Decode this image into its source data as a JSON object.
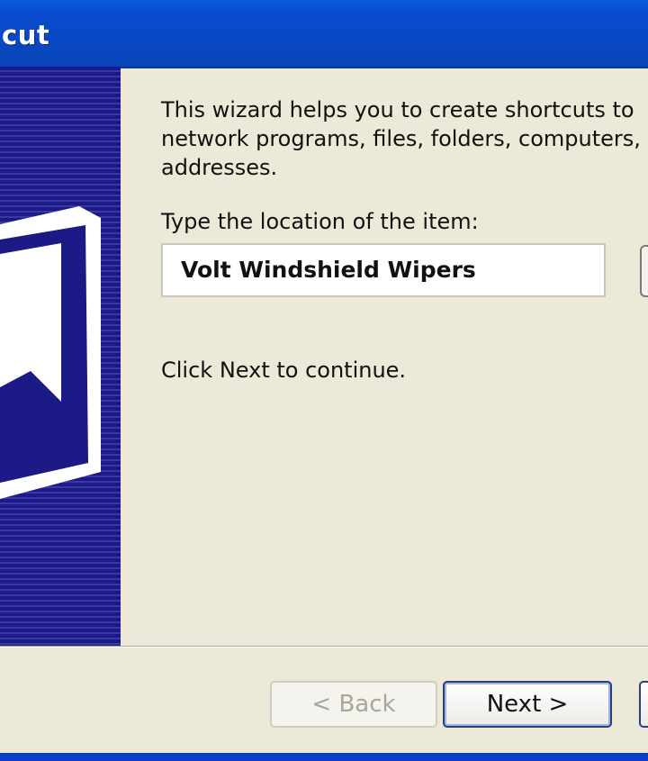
{
  "window": {
    "title": "cut"
  },
  "wizard": {
    "description": "This wizard helps you to create shortcuts to\nnetwork programs, files, folders, computers,\naddresses.",
    "location_label": "Type the location of the item:",
    "location_value": "Volt Windshield Wipers",
    "continue_hint": "Click Next to continue."
  },
  "buttons": {
    "back_label": "< Back",
    "next_label": "Next >"
  },
  "icons": {
    "sidebar": "shortcut-book-icon",
    "browse": "browse-button"
  }
}
